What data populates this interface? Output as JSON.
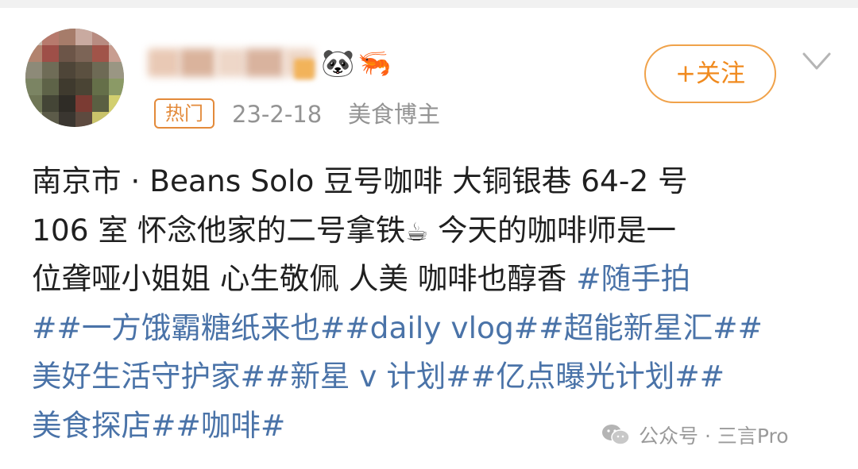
{
  "post": {
    "follow_label": "+关注",
    "hot_tag": "热门",
    "date": "23-2-18",
    "category": "美食博主",
    "emoji_1": "🐼",
    "emoji_2": "🦐",
    "coffee_emoji": "☕",
    "lines": {
      "l1": "南京市 · Beans Solo 豆号咖啡 大铜银巷 64-2 号",
      "l2a": "106 室  怀念他家的二号拿铁",
      "l2b": "  今天的咖啡师是一",
      "l3a": "位聋哑小姐姐 心生敬佩 人美 咖啡也醇香 ",
      "l3b": "#随手拍",
      "l4": "##一方饿霸糖纸来也##daily vlog##超能新星汇##",
      "l5": "美好生活守护家##新星 v 计划##亿点曝光计划##",
      "l6": "美食探店##咖啡#"
    }
  },
  "watermark": {
    "text": "公众号 · 三言Pro"
  },
  "colors": {
    "hashtag": "#4a73a8",
    "accent_orange": "#f08a1e",
    "meta_gray": "#939393"
  }
}
